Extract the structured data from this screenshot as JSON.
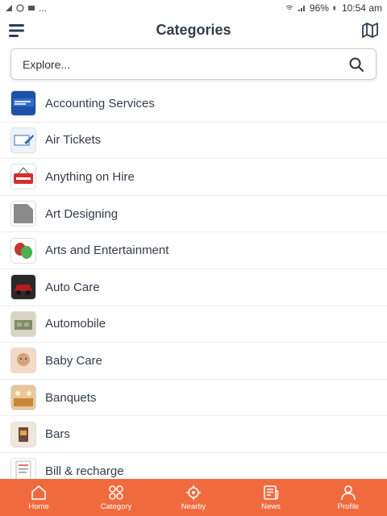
{
  "status_bar": {
    "battery": "96%",
    "time": "10:54 am",
    "dots": "..."
  },
  "header": {
    "title": "Categories"
  },
  "search": {
    "placeholder": "Explore..."
  },
  "categories": [
    {
      "label": "Accounting Services",
      "icon": "accounting-thumb-icon",
      "color": "#1f4fa8"
    },
    {
      "label": "Air Tickets",
      "icon": "air-tickets-thumb-icon",
      "color": "#3a6fb5"
    },
    {
      "label": "Anything on Hire",
      "icon": "hiring-sign-icon",
      "color": "#d32f2f"
    },
    {
      "label": "Art Designing",
      "icon": "art-thumb-icon",
      "color": "#8a8a8a"
    },
    {
      "label": "Arts and Entertainment",
      "icon": "theatre-masks-icon",
      "color": "#c0392b"
    },
    {
      "label": "Auto Care",
      "icon": "auto-care-thumb-icon",
      "color": "#b71c1c"
    },
    {
      "label": "Automobile",
      "icon": "automobile-thumb-icon",
      "color": "#7a8b6b"
    },
    {
      "label": "Baby Care",
      "icon": "baby-thumb-icon",
      "color": "#d7a27e"
    },
    {
      "label": "Banquets",
      "icon": "banquets-thumb-icon",
      "color": "#c9873c"
    },
    {
      "label": "Bars",
      "icon": "bars-thumb-icon",
      "color": "#6d4c3d"
    },
    {
      "label": "Bill & recharge",
      "icon": "bill-thumb-icon",
      "color": "#e57373"
    }
  ],
  "bottom_nav": [
    {
      "label": "Home",
      "icon": "home-icon"
    },
    {
      "label": "Category",
      "icon": "category-icon"
    },
    {
      "label": "Nearby",
      "icon": "nearby-icon"
    },
    {
      "label": "News",
      "icon": "news-icon"
    },
    {
      "label": "Profile",
      "icon": "profile-icon"
    }
  ],
  "colors": {
    "accent": "#f06a3e",
    "title": "#333c4c"
  }
}
